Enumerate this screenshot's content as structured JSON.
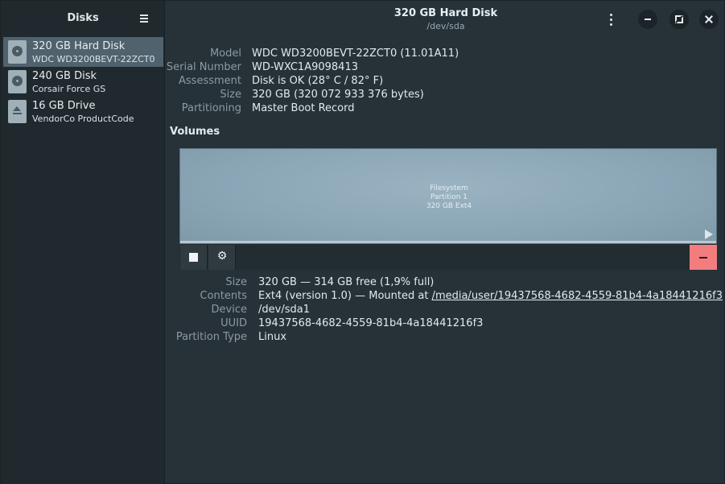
{
  "sidebar": {
    "title": "Disks",
    "items": [
      {
        "name": "320 GB Hard Disk",
        "sub": "WDC WD3200BEVT-22ZCT0",
        "icon": "hard-disk-icon",
        "selected": true
      },
      {
        "name": "240 GB Disk",
        "sub": "Corsair Force GS",
        "icon": "hard-disk-icon",
        "selected": false
      },
      {
        "name": "16 GB Drive",
        "sub": "VendorCo ProductCode",
        "icon": "eject-icon",
        "selected": false
      }
    ]
  },
  "header": {
    "title": "320 GB Hard Disk",
    "subtitle": "/dev/sda"
  },
  "disk_info": {
    "model_label": "Model",
    "model_value": "WDC WD3200BEVT-22ZCT0 (11.01A11)",
    "serial_label": "Serial Number",
    "serial_value": "WD-WXC1A9098413",
    "assessment_label": "Assessment",
    "assessment_value": "Disk is OK (28° C / 82° F)",
    "size_label": "Size",
    "size_value": "320 GB (320 072 933 376 bytes)",
    "partitioning_label": "Partitioning",
    "partitioning_value": "Master Boot Record"
  },
  "volumes": {
    "title": "Volumes",
    "graphic_line1": "Filesystem",
    "graphic_line2": "Partition 1",
    "graphic_line3": "320 GB Ext4"
  },
  "partition_info": {
    "size_label": "Size",
    "size_value": "320 GB — 314 GB free (1,9% full)",
    "contents_label": "Contents",
    "contents_prefix": "Ext4 (version 1.0) — Mounted at ",
    "contents_link": "/media/user/19437568-4682-4559-81b4-4a18441216f3",
    "device_label": "Device",
    "device_value": "/dev/sda1",
    "uuid_label": "UUID",
    "uuid_value": "19437568-4682-4559-81b4-4a18441216f3",
    "type_label": "Partition Type",
    "type_value": "Linux"
  },
  "colors": {
    "background": "#263238",
    "sidebar": "#1f292e",
    "selected": "#4f626d",
    "volume_fill": "#8aa5b5",
    "delete": "#f27d7f"
  }
}
